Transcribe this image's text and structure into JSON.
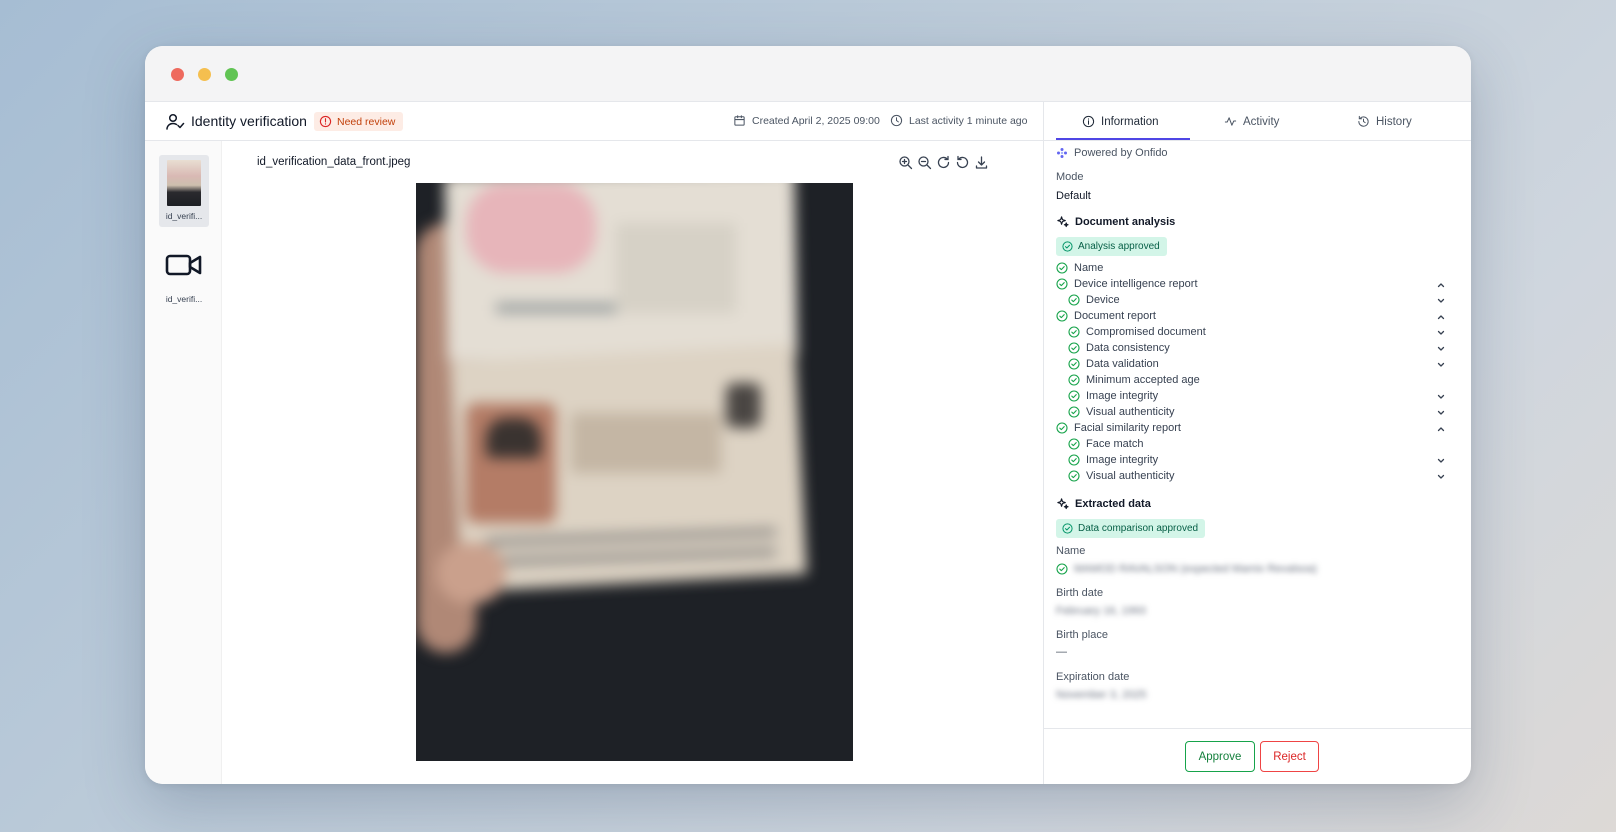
{
  "window": {
    "controls": [
      "close",
      "minimize",
      "maximize"
    ]
  },
  "header": {
    "title": "Identity verification",
    "status_badge": "Need review",
    "created": "Created April 2, 2025 09:00",
    "last_activity": "Last activity 1 minute ago"
  },
  "thumbnails": [
    {
      "label": "id_verifi...",
      "type": "image",
      "selected": true
    },
    {
      "label": "id_verifi...",
      "type": "video",
      "selected": false
    }
  ],
  "viewer": {
    "file_name": "id_verification_data_front.jpeg",
    "tools": [
      "zoom-in-icon",
      "zoom-out-icon",
      "rotate-right-icon",
      "rotate-left-icon",
      "download-icon"
    ]
  },
  "tabs": [
    {
      "label": "Information",
      "icon": "info-icon",
      "active": true
    },
    {
      "label": "Activity",
      "icon": "activity-icon",
      "active": false
    },
    {
      "label": "History",
      "icon": "history-icon",
      "active": false
    }
  ],
  "info": {
    "powered_by": "Powered by Onfido",
    "mode_label": "Mode",
    "mode_value": "Default",
    "document_analysis": {
      "title": "Document analysis",
      "badge": "Analysis approved",
      "checks": [
        {
          "label": "Name",
          "level": 0,
          "chevron": ""
        },
        {
          "label": "Device intelligence report",
          "level": 0,
          "chevron": "up"
        },
        {
          "label": "Device",
          "level": 1,
          "chevron": "down"
        },
        {
          "label": "Document report",
          "level": 0,
          "chevron": "up"
        },
        {
          "label": "Compromised document",
          "level": 1,
          "chevron": "down"
        },
        {
          "label": "Data consistency",
          "level": 1,
          "chevron": "down"
        },
        {
          "label": "Data validation",
          "level": 1,
          "chevron": "down"
        },
        {
          "label": "Minimum accepted age",
          "level": 1,
          "chevron": ""
        },
        {
          "label": "Image integrity",
          "level": 1,
          "chevron": "down"
        },
        {
          "label": "Visual authenticity",
          "level": 1,
          "chevron": "down"
        },
        {
          "label": "Facial similarity report",
          "level": 0,
          "chevron": "up"
        },
        {
          "label": "Face match",
          "level": 1,
          "chevron": ""
        },
        {
          "label": "Image integrity",
          "level": 1,
          "chevron": "down"
        },
        {
          "label": "Visual authenticity",
          "level": 1,
          "chevron": "down"
        }
      ]
    },
    "extracted_data": {
      "title": "Extracted data",
      "badge": "Data comparison approved",
      "fields": [
        {
          "label": "Name",
          "value": "MAMOD RAVALSON (expected Mamix Revalsoa)",
          "redacted": true
        },
        {
          "label": "Birth date",
          "value": "February 16, 1993",
          "redacted": true
        },
        {
          "label": "Birth place",
          "value": "—",
          "redacted": false
        },
        {
          "label": "Expiration date",
          "value": "November 3, 2025",
          "redacted": true
        }
      ]
    }
  },
  "actions": {
    "approve": "Approve",
    "reject": "Reject"
  },
  "colors": {
    "accent": "#4f46e5",
    "approve": "#16a34a",
    "reject": "#ef4444",
    "warning": "#c2410c",
    "success_bg": "#d3f5e8"
  }
}
